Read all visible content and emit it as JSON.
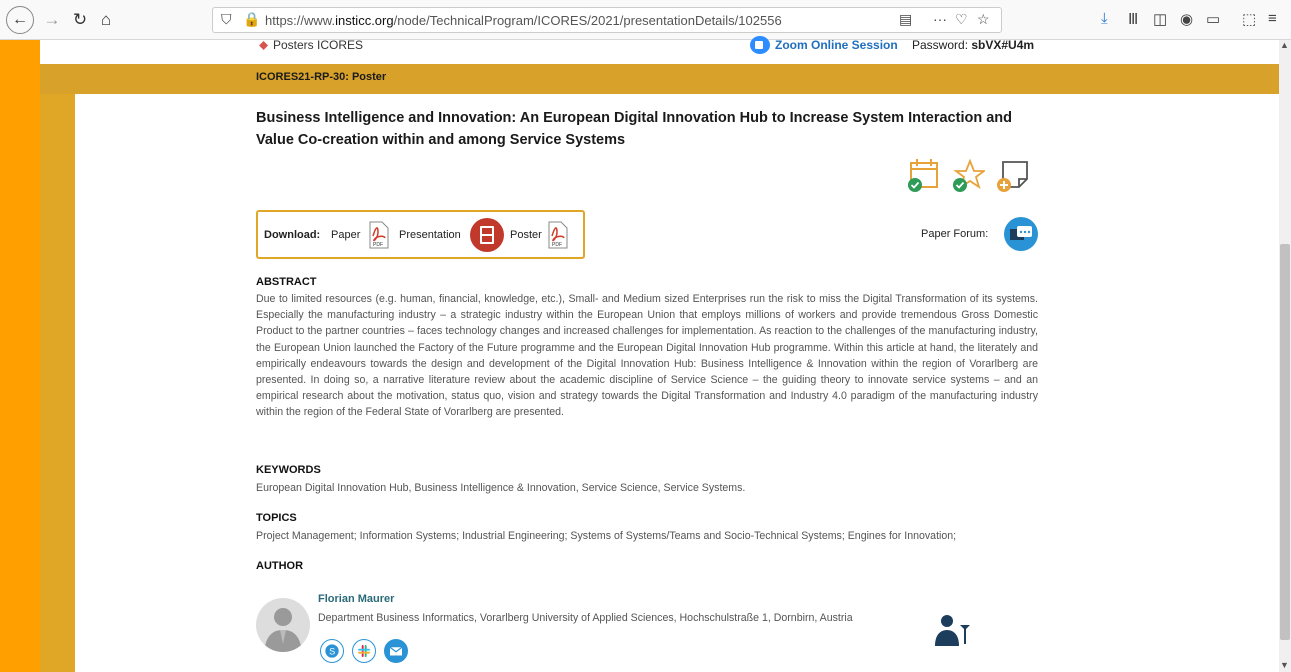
{
  "browser": {
    "url_prefix": "https://www.",
    "url_domain": "insticc.org",
    "url_path": "/node/TechnicalProgram/ICORES/2021/presentationDetails/102556"
  },
  "session": {
    "location": "Posters ICORES",
    "zoom_label": "Zoom Online Session",
    "password_label": "Password:",
    "password_value": "sbVX#U4m",
    "code": "ICORES21-RP-30: Poster"
  },
  "paper": {
    "title": "Business Intelligence and Innovation: An European Digital Innovation Hub to Increase System Interaction and Value Co-creation within and among Service Systems"
  },
  "download": {
    "label": "Download:",
    "paper": "Paper",
    "presentation": "Presentation",
    "poster": "Poster",
    "pdf_badge": "PDF"
  },
  "forum": {
    "label": "Paper Forum:"
  },
  "abstract": {
    "heading": "ABSTRACT",
    "text": "Due to limited resources (e.g. human, financial, knowledge, etc.), Small- and Medium sized Enterprises run the risk to miss the Digital Transformation of its systems. Especially the manufacturing industry – a strategic industry within the European Union that employs millions of workers and provide tremendous Gross Domestic Product to the partner countries – faces technology changes and increased challenges for implementation. As reaction to the challenges of the manufacturing industry, the European Union launched the Factory of the Future programme and the European Digital Innovation Hub programme. Within this article at hand, the literately and empirically endeavours towards the design and development of the Digital Innovation Hub: Business Intelligence & Innovation within the region of Vorarlberg are presented. In doing so, a narrative literature review about the academic discipline of Service Science – the guiding theory to innovate service systems – and an empirical research about the motivation, status quo, vision and strategy towards the Digital Transformation and Industry 4.0 paradigm of the manufacturing industry within the region of the Federal State of Vorarlberg are presented."
  },
  "keywords": {
    "heading": "KEYWORDS",
    "text": "European Digital Innovation Hub, Business Intelligence & Innovation, Service Science, Service Systems."
  },
  "topics": {
    "heading": "TOPICS",
    "text": "Project Management; Information Systems; Industrial Engineering; Systems of Systems/Teams and Socio-Technical Systems; Engines for Innovation;"
  },
  "author": {
    "heading": "AUTHOR",
    "name": "Florian Maurer",
    "affiliation": "Department Business Informatics, Vorarlberg University of Applied Sciences, Hochschulstraße 1, Dornbirn, Austria"
  },
  "colors": {
    "accent_orange": "#ffa000",
    "accent_gold": "#d8a22a",
    "link_blue": "#2a93d5",
    "check_green": "#2e9b57"
  }
}
